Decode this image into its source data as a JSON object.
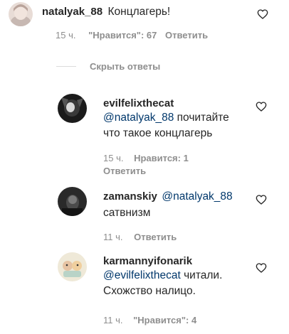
{
  "comments": [
    {
      "username": "natalyak_88",
      "text": "Концлагерь!",
      "time": "15 ч.",
      "likes": "\"Нравится\": 67",
      "reply": "Ответить"
    },
    {
      "username": "evilfelixthecat",
      "mention": "@natalyak_88",
      "text_line1_rest": "почитайте",
      "text_line2": "что такое концлагерь",
      "time": "15 ч.",
      "likes": "Нравится: 1",
      "reply": "Ответить"
    },
    {
      "username": "zamanskiy",
      "mention": "@natalyak_88",
      "text": "сатвнизм",
      "time": "11 ч.",
      "reply": "Ответить"
    },
    {
      "username": "karmannyifonarik",
      "mention": "@evilfelixthecat",
      "text_line1_rest": "читали.",
      "text_line2": "Схожство налицо.",
      "time": "11 ч.",
      "likes": "\"Нравится\": 4"
    }
  ],
  "hide_replies": "Скрыть ответы",
  "icons": {
    "like": "heart-outline-icon"
  }
}
